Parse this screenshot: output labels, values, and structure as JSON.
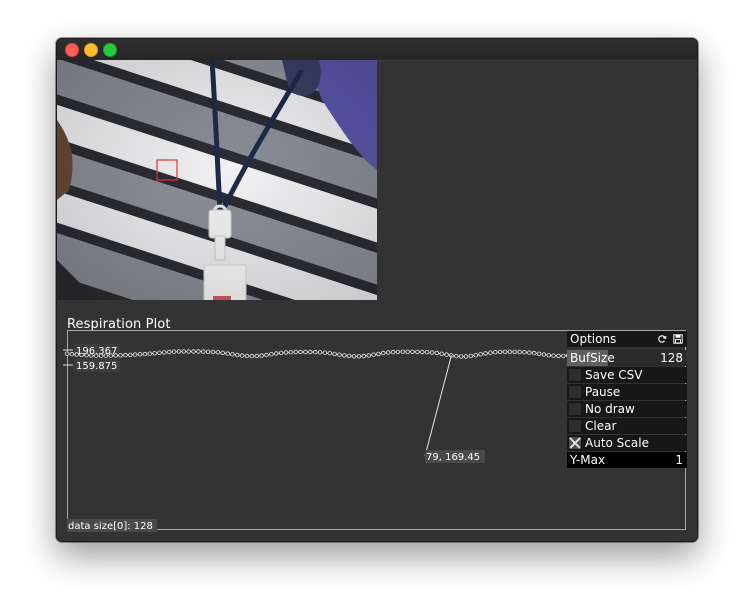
{
  "window": {
    "traffic_lights": [
      "close",
      "minimize",
      "zoom"
    ]
  },
  "camera": {
    "description_icon": "webcam-frame"
  },
  "plot": {
    "title": "Respiration Plot",
    "y_max_label": "196.367",
    "y_min_label": "159.875",
    "cursor_readout": "79, 169.45",
    "data_size_label": "data size[0]: 128"
  },
  "options": {
    "header": "Options",
    "buf_size_label": "BufSize",
    "buf_size_value": "128",
    "buf_size_fill": 0.34,
    "save_csv": "Save CSV",
    "pause": "Pause",
    "no_draw": "No draw",
    "clear": "Clear",
    "auto_scale": "Auto Scale",
    "auto_scale_checked": true,
    "y_max_label": "Y-Max",
    "y_max_value": "1",
    "icons": [
      "refresh-icon",
      "save-disk-icon"
    ]
  },
  "chart_data": {
    "type": "line",
    "title": "Respiration Plot",
    "xlabel": "",
    "ylabel": "",
    "ylim": [
      159.875,
      196.367
    ],
    "xlim": [
      0,
      127
    ],
    "series": [
      {
        "values": [
          187.2,
          186.5,
          185.4,
          184.4,
          183.6,
          183.0,
          182.6,
          182.4,
          182.5,
          182.7,
          183.1,
          183.5,
          184.0,
          184.5,
          185.1,
          185.8,
          186.5,
          187.4,
          188.4,
          189.5,
          190.6,
          191.5,
          192.2,
          192.6,
          192.8,
          192.8,
          192.7,
          192.6,
          192.4,
          192.1,
          191.6,
          190.7,
          189.3,
          187.6,
          185.8,
          184.1,
          182.7,
          181.8,
          181.5,
          181.8,
          182.8,
          184.3,
          186.1,
          187.9,
          189.4,
          190.4,
          191.0,
          191.4,
          191.6,
          191.6,
          191.5,
          191.3,
          190.8,
          189.9,
          188.5,
          186.8,
          185.0,
          183.3,
          181.9,
          181.1,
          181.0,
          181.6,
          183.0,
          184.9,
          186.9,
          188.8,
          190.3,
          191.2,
          191.7,
          191.9,
          191.9,
          191.9,
          191.8,
          191.6,
          191.1,
          190.3,
          189.0,
          187.2,
          185.1,
          183.0,
          181.4,
          180.7,
          180.9,
          181.9,
          183.7,
          185.9,
          188.0,
          189.8,
          191.0,
          191.7,
          191.9,
          191.9,
          191.8,
          191.5,
          191.0,
          190.1,
          188.8,
          187.1,
          185.3,
          183.7,
          182.5,
          181.9,
          182.0,
          182.8,
          184.1,
          185.6,
          187.0,
          188.2,
          189.1,
          189.6,
          189.8,
          189.6,
          189.1,
          188.3,
          187.3,
          186.2,
          185.1,
          184.2,
          183.5,
          183.2,
          183.2,
          183.5,
          184.0,
          184.6,
          185.2,
          185.7,
          186.1,
          186.3
        ]
      }
    ],
    "cursor_point": {
      "x": 79,
      "y": 169.45
    },
    "grid": false,
    "legend": "none"
  }
}
